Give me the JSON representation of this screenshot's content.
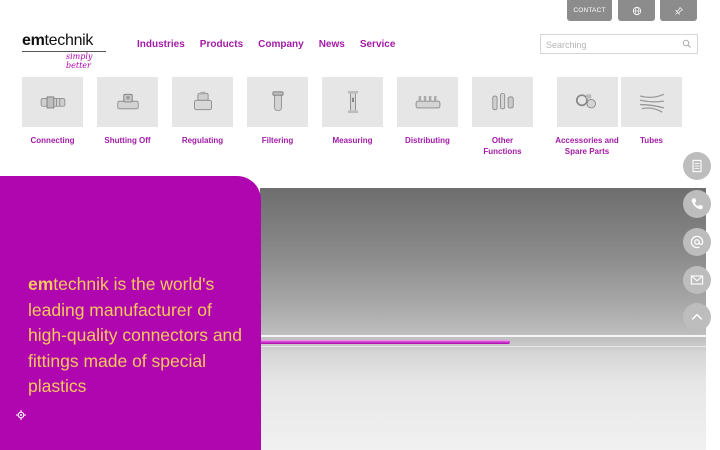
{
  "top_buttons": {
    "contact_label": "CONTACT",
    "language_icon": "globe-icon",
    "pin_icon": "pin-icon"
  },
  "logo": {
    "brand_bold": "em",
    "brand_rest": "technik",
    "tagline": "simply better"
  },
  "nav": {
    "items": [
      "Industries",
      "Products",
      "Company",
      "News",
      "Service"
    ]
  },
  "search": {
    "placeholder": "Searching",
    "icon": "search-icon"
  },
  "categories": [
    {
      "label": "Connecting",
      "icon": "connector-icon"
    },
    {
      "label": "Shutting Off",
      "icon": "valve-icon"
    },
    {
      "label": "Regulating",
      "icon": "regulator-icon"
    },
    {
      "label": "Filtering",
      "icon": "filter-icon"
    },
    {
      "label": "Measuring",
      "icon": "flowmeter-icon"
    },
    {
      "label": "Distributing",
      "icon": "manifold-icon"
    },
    {
      "label": "Other Functions",
      "icon": "fittings-icon"
    },
    {
      "label": "Accessories and Spare Parts",
      "icon": "accessories-icon"
    },
    {
      "label": "Tubes",
      "icon": "tubes-icon"
    }
  ],
  "hero": {
    "brand_bold": "em",
    "text_rest": "technik is the world's leading manufacturer of high-quality connectors and fittings made of special plastics"
  },
  "side_buttons": [
    "document-icon",
    "phone-icon",
    "at-icon",
    "mail-icon",
    "scroll-up-icon"
  ],
  "colors": {
    "brand_purple": "#a21ba6",
    "hero_purple": "#b006b0",
    "hero_text": "#f7c85b",
    "button_gray": "#8c8c8c"
  }
}
